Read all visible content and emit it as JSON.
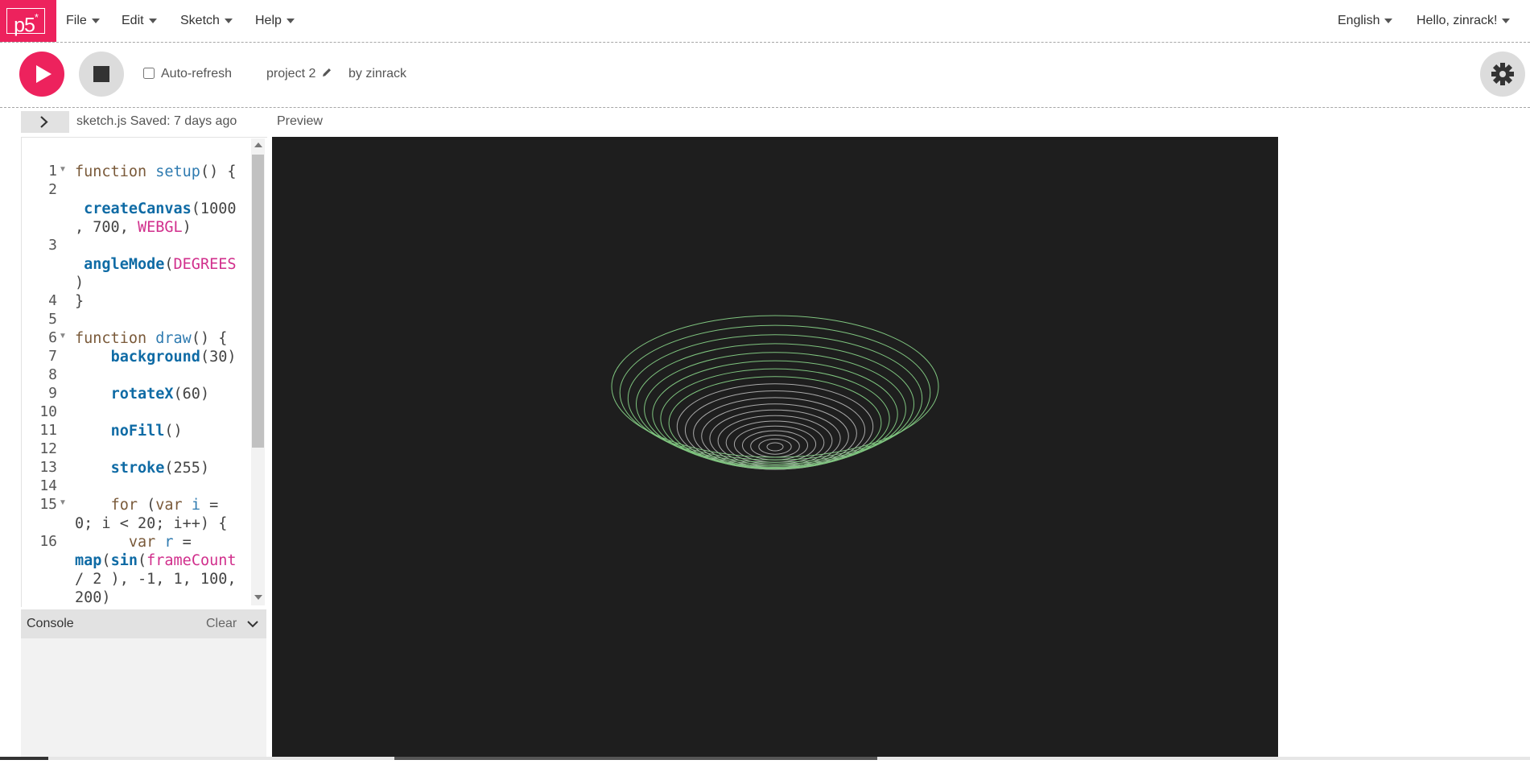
{
  "nav": {
    "logo_text": "p5",
    "logo_sup": "*",
    "menus": [
      "File",
      "Edit",
      "Sketch",
      "Help"
    ],
    "language": "English",
    "user": "Hello, zinrack!"
  },
  "toolbar": {
    "auto_refresh_label": "Auto-refresh",
    "auto_refresh_checked": false,
    "project_name": "project 2",
    "owner": "by zinrack"
  },
  "editor": {
    "file_name": "sketch.js",
    "saved_status": "Saved: 7 days ago",
    "preview_label": "Preview",
    "line_numbers": [
      "1",
      "2",
      "3",
      "4",
      "5",
      "6",
      "7",
      "8",
      "9",
      "10",
      "11",
      "12",
      "13",
      "14",
      "15",
      "16"
    ],
    "folded_lines": [
      "1",
      "6",
      "15"
    ]
  },
  "code": {
    "l1_kw": "function",
    "l1_fn": "setup",
    "l1_rest": "() {",
    "l2_fn": "createCanvas",
    "l2_rest": "(1000",
    "l2b_a": ", 700, ",
    "l2b_const": "WEBGL",
    "l2b_b": ")",
    "l3_fn": "angleMode",
    "l3_open": "(",
    "l3_const": "DEGREES",
    "l3b": ")",
    "l4": "}",
    "l6_kw": "function",
    "l6_fn": "draw",
    "l6_rest": "() {",
    "l7_fn": "background",
    "l7_rest": "(30)",
    "l9_fn": "rotateX",
    "l9_rest": "(60)",
    "l11_fn": "noFill",
    "l11_rest": "()",
    "l13_fn": "stroke",
    "l13_rest": "(255)",
    "l15_kw": "for",
    "l15_a": " (",
    "l15_var": "var",
    "l15_b": " ",
    "l15_i": "i",
    "l15_c": " =",
    "l15b": "0; i < 20; i++) {",
    "l16_kw": "var",
    "l16_b": " ",
    "l16_r": "r",
    "l16_c": " =",
    "l16b_fn": "map",
    "l16b_a": "(",
    "l16b_fn2": "sin",
    "l16b_b": "(",
    "l16b_const": "frameCount",
    "l16c": "/ 2 ), -1, 1, 100,",
    "l16d": "200)"
  },
  "console": {
    "title": "Console",
    "clear_label": "Clear"
  },
  "colors": {
    "accent": "#ed225d",
    "canvas_bg": "#1e1e1e",
    "ring_stroke": "#7fc47f"
  },
  "icons": {
    "play": "play-icon",
    "stop": "stop-icon",
    "settings": "gear-icon",
    "edit": "pencil-icon",
    "expand": "chevron-right-icon",
    "console_toggle": "chevron-down-icon"
  }
}
